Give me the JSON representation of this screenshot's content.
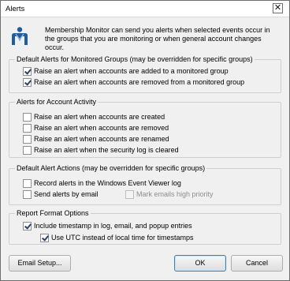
{
  "window": {
    "title": "Alerts",
    "close_glyph": "✕"
  },
  "intro": {
    "text": "Membership Monitor can send you alerts when selected events occur in the groups that you are monitoring or when general account changes occur."
  },
  "groups": [
    {
      "label": "Default Alerts for Monitored Groups (may be overridden for specific groups)",
      "options": [
        {
          "label": "Raise an alert when accounts are added to a monitored group",
          "checked": true
        },
        {
          "label": "Raise an alert when accounts are removed from a monitored group",
          "checked": true
        }
      ]
    },
    {
      "label": "Alerts for Account Activity",
      "options": [
        {
          "label": "Raise an alert when accounts are created",
          "checked": false
        },
        {
          "label": "Raise an alert when accounts are removed",
          "checked": false
        },
        {
          "label": "Raise an alert when accounts are renamed",
          "checked": false
        },
        {
          "label": "Raise an alert when the security log is cleared",
          "checked": false
        }
      ]
    },
    {
      "label": "Default Alert Actions (may be overridden for specific groups)",
      "options": [
        {
          "label": "Record alerts in the Windows Event Viewer log",
          "checked": false
        },
        {
          "label": "Send alerts by email",
          "checked": false
        },
        {
          "label": "Mark emails high priority",
          "checked": false,
          "disabled": true
        }
      ]
    },
    {
      "label": "Report Format Options",
      "options": [
        {
          "label": "Include timestamp in log, email, and popup entries",
          "checked": true
        },
        {
          "label": "Use UTC instead of local time for timestamps",
          "checked": true
        }
      ]
    }
  ],
  "buttons": {
    "email_setup": "Email Setup...",
    "ok": "OK",
    "cancel": "Cancel"
  },
  "colors": {
    "checkmark": "#2a3f6a",
    "default_button_border": "#3c7fb1"
  },
  "icons": {
    "app": "membership-monitor-icon",
    "close": "close-icon"
  }
}
